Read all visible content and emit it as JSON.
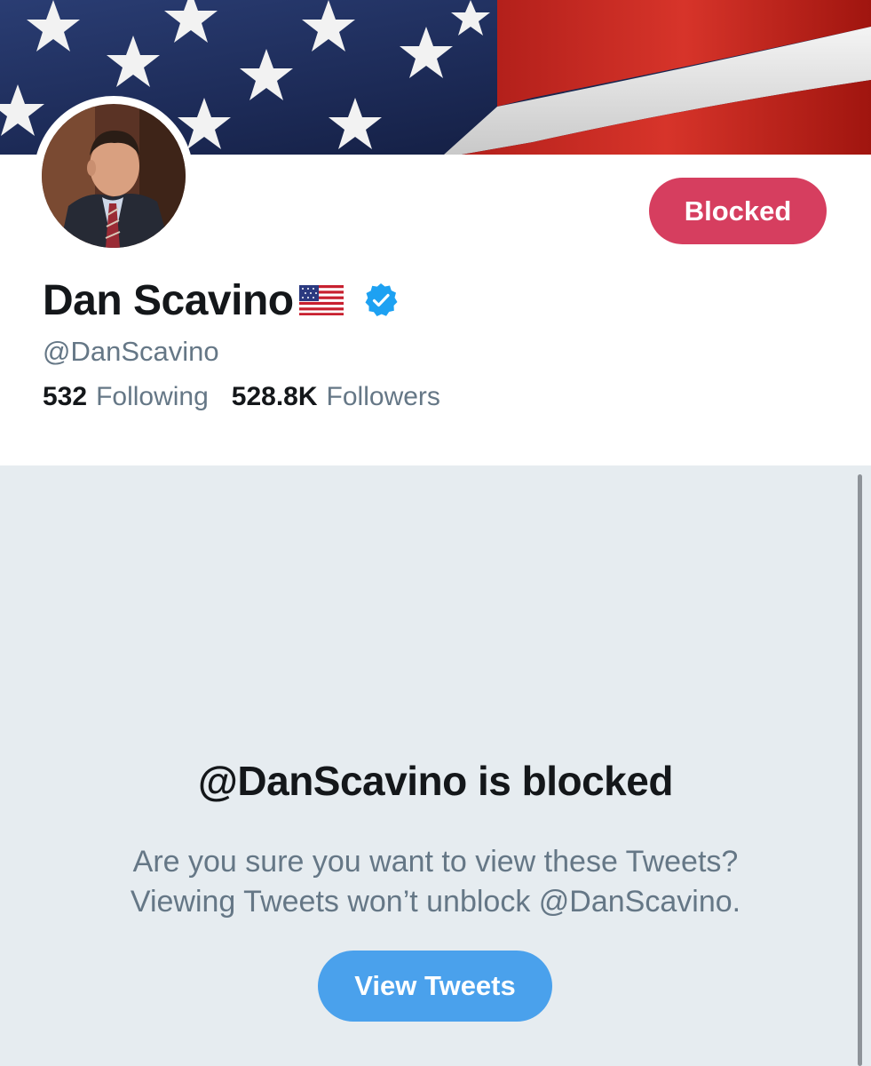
{
  "profile": {
    "display_name": "Dan Scavino",
    "handle": "@DanScavino",
    "following_count": "532",
    "following_label": "Following",
    "followers_count": "528.8K",
    "followers_label": "Followers",
    "action_button_label": "Blocked",
    "name_emoji_icon": "us-flag-icon",
    "verified_icon": "verified-badge-icon"
  },
  "blocked_notice": {
    "title": "@DanScavino is blocked",
    "line1": "Are you sure you want to view these Tweets?",
    "line2": "Viewing Tweets won’t unblock @DanScavino.",
    "button_label": "View Tweets"
  },
  "colors": {
    "blocked_button": "#d63e5f",
    "view_button": "#4aa1ec",
    "verified_blue": "#1da1f2",
    "panel_bg": "#e6ecf0",
    "secondary_text": "#657786",
    "primary_text": "#14171a"
  }
}
